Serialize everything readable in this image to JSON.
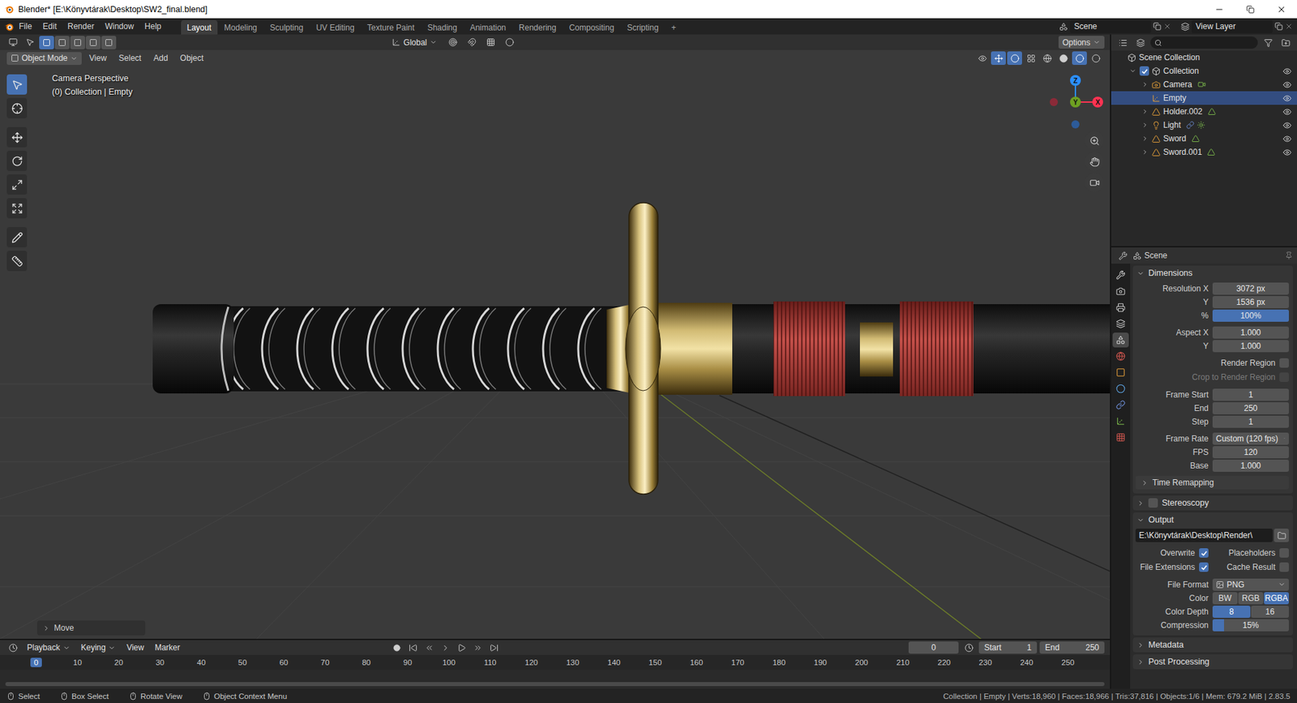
{
  "window": {
    "title": "Blender* [E:\\Könyvtárak\\Desktop\\SW2_final.blend]"
  },
  "topbar": {
    "menus": [
      "File",
      "Edit",
      "Render",
      "Window",
      "Help"
    ],
    "workspaces": [
      {
        "label": "Layout",
        "selected": true
      },
      {
        "label": "Modeling",
        "selected": false
      },
      {
        "label": "Sculpting",
        "selected": false
      },
      {
        "label": "UV Editing",
        "selected": false
      },
      {
        "label": "Texture Paint",
        "selected": false
      },
      {
        "label": "Shading",
        "selected": false
      },
      {
        "label": "Animation",
        "selected": false
      },
      {
        "label": "Rendering",
        "selected": false
      },
      {
        "label": "Compositing",
        "selected": false
      },
      {
        "label": "Scripting",
        "selected": false
      }
    ],
    "add_workspace": "+",
    "scene": "Scene",
    "view_layer": "View Layer"
  },
  "tool_header": {
    "orientation": "Global",
    "options": "Options"
  },
  "viewport_header": {
    "mode": "Object Mode",
    "menus": [
      "View",
      "Select",
      "Add",
      "Object"
    ]
  },
  "viewport": {
    "view_name": "Camera Perspective",
    "context": "(0) Collection | Empty",
    "gizmo": {
      "z": "Z",
      "y": "Y",
      "x": "X"
    },
    "tools": [
      {
        "kind": "select-box",
        "selected": true
      },
      {
        "kind": "cursor",
        "selected": false
      },
      {
        "kind": "move",
        "selected": false
      },
      {
        "kind": "rotate",
        "selected": false
      },
      {
        "kind": "scale",
        "selected": false
      },
      {
        "kind": "transform",
        "selected": false
      },
      {
        "kind": "annotate",
        "selected": false
      },
      {
        "kind": "measure",
        "selected": false
      }
    ],
    "last_operator": "Move"
  },
  "outliner": {
    "items": [
      {
        "name": "Scene Collection",
        "kind": "scene-collection",
        "depth": 0,
        "expandable": false,
        "expanded": false,
        "selected": false
      },
      {
        "name": "Collection",
        "kind": "collection",
        "depth": 1,
        "expandable": true,
        "expanded": true,
        "included": true,
        "selected": false,
        "visible": true
      },
      {
        "name": "Camera",
        "kind": "camera",
        "depth": 2,
        "expandable": true,
        "expanded": false,
        "selected": false,
        "visible": true
      },
      {
        "name": "Empty",
        "kind": "empty",
        "depth": 2,
        "expandable": false,
        "expanded": false,
        "selected": true,
        "visible": true
      },
      {
        "name": "Holder.002",
        "kind": "mesh",
        "depth": 2,
        "expandable": true,
        "expanded": false,
        "selected": false,
        "visible": true
      },
      {
        "name": "Light",
        "kind": "light",
        "depth": 2,
        "expandable": true,
        "expanded": false,
        "selected": false,
        "visible": true
      },
      {
        "name": "Sword",
        "kind": "mesh",
        "depth": 2,
        "expandable": true,
        "expanded": false,
        "selected": false,
        "visible": true
      },
      {
        "name": "Sword.001",
        "kind": "mesh",
        "depth": 2,
        "expandable": true,
        "expanded": false,
        "selected": false,
        "visible": true
      }
    ]
  },
  "properties": {
    "context": "Scene",
    "tabs": [
      {
        "kind": "tool",
        "selected": false
      },
      {
        "kind": "render",
        "selected": false
      },
      {
        "kind": "output",
        "selected": false
      },
      {
        "kind": "view-layer",
        "selected": false
      },
      {
        "kind": "scene",
        "selected": true
      },
      {
        "kind": "world",
        "selected": false
      },
      {
        "kind": "object",
        "selected": false
      },
      {
        "kind": "physics",
        "selected": false
      },
      {
        "kind": "constraints",
        "selected": false
      },
      {
        "kind": "data",
        "selected": false
      },
      {
        "kind": "texture",
        "selected": false
      }
    ],
    "panels": [
      {
        "title": "Dimensions",
        "kind": "plain",
        "expanded": true,
        "groups": [
          [
            {
              "kind": "number",
              "label": "Resolution X",
              "value": "3072 px"
            },
            {
              "kind": "number",
              "label": "Y",
              "value": "1536 px"
            },
            {
              "kind": "slider",
              "label": "%",
              "value": "100%",
              "level": 1
            }
          ],
          [
            {
              "kind": "number",
              "label": "Aspect X",
              "value": "1.000"
            },
            {
              "kind": "number",
              "label": "Y",
              "value": "1.000"
            }
          ],
          [
            {
              "kind": "checkbox",
              "label": "Render Region",
              "checked": false,
              "disabled": false
            },
            {
              "kind": "checkbox",
              "label": "Crop to Render Region",
              "checked": false,
              "disabled": true
            }
          ],
          [
            {
              "kind": "number",
              "label": "Frame Start",
              "value": "1"
            },
            {
              "kind": "number",
              "label": "End",
              "value": "250"
            },
            {
              "kind": "number",
              "label": "Step",
              "value": "1"
            }
          ],
          [
            {
              "kind": "select",
              "label": "Frame Rate",
              "value": "Custom (120 fps)"
            },
            {
              "kind": "number",
              "label": "FPS",
              "value": "120"
            },
            {
              "kind": "number",
              "label": "Base",
              "value": "1.000"
            }
          ],
          [
            {
              "kind": "subpanel",
              "label": "Time Remapping",
              "expanded": false
            }
          ]
        ]
      },
      {
        "title": "Stereoscopy",
        "kind": "checkbox",
        "checked": false,
        "expanded": false
      },
      {
        "title": "Output",
        "kind": "plain",
        "expanded": true,
        "groups": [
          [
            {
              "kind": "path",
              "value": "E:\\Könyvtárak\\Desktop\\Render\\"
            }
          ],
          [
            {
              "kind": "check-pair",
              "items": [
                {
                  "label": "Overwrite",
                  "checked": true
                },
                {
                  "label": "Placeholders",
                  "checked": false
                }
              ]
            },
            {
              "kind": "check-pair",
              "items": [
                {
                  "label": "File Extensions",
                  "checked": true
                },
                {
                  "label": "Cache Result",
                  "checked": false
                }
              ]
            }
          ],
          [
            {
              "kind": "select",
              "label": "File Format",
              "value": "PNG"
            },
            {
              "kind": "segmented",
              "label": "Color",
              "options": [
                {
                  "label": "BW",
                  "selected": false
                },
                {
                  "label": "RGB",
                  "selected": false
                },
                {
                  "label": "RGBA",
                  "selected": true
                }
              ]
            },
            {
              "kind": "segmented",
              "label": "Color Depth",
              "options": [
                {
                  "label": "8",
                  "selected": true
                },
                {
                  "label": "16",
                  "selected": false
                }
              ]
            },
            {
              "kind": "slider",
              "label": "Compression",
              "value": "15%",
              "level": 0.15
            }
          ]
        ]
      },
      {
        "title": "Metadata",
        "kind": "plain",
        "expanded": false
      },
      {
        "title": "Post Processing",
        "kind": "plain",
        "expanded": false
      }
    ]
  },
  "timeline": {
    "menus": [
      {
        "label": "Playback",
        "dropdown": true
      },
      {
        "label": "Keying",
        "dropdown": true
      },
      {
        "label": "View",
        "dropdown": false
      },
      {
        "label": "Marker",
        "dropdown": false
      }
    ],
    "current_frame": "0",
    "start_label": "Start",
    "start": "1",
    "end_label": "End",
    "end": "250",
    "ruler": [
      {
        "label": "0",
        "current": true
      },
      {
        "label": "10",
        "current": false
      },
      {
        "label": "20",
        "current": false
      },
      {
        "label": "30",
        "current": false
      },
      {
        "label": "40",
        "current": false
      },
      {
        "label": "50",
        "current": false
      },
      {
        "label": "60",
        "current": false
      },
      {
        "label": "70",
        "current": false
      },
      {
        "label": "80",
        "current": false
      },
      {
        "label": "90",
        "current": false
      },
      {
        "label": "100",
        "current": false
      },
      {
        "label": "110",
        "current": false
      },
      {
        "label": "120",
        "current": false
      },
      {
        "label": "130",
        "current": false
      },
      {
        "label": "140",
        "current": false
      },
      {
        "label": "150",
        "current": false
      },
      {
        "label": "160",
        "current": false
      },
      {
        "label": "170",
        "current": false
      },
      {
        "label": "180",
        "current": false
      },
      {
        "label": "190",
        "current": false
      },
      {
        "label": "200",
        "current": false
      },
      {
        "label": "210",
        "current": false
      },
      {
        "label": "220",
        "current": false
      },
      {
        "label": "230",
        "current": false
      },
      {
        "label": "240",
        "current": false
      },
      {
        "label": "250",
        "current": false
      }
    ]
  },
  "status_bar": {
    "hints": [
      "Select",
      "Box Select",
      "Rotate View",
      "Object Context Menu"
    ],
    "stats": "Collection | Empty | Verts:18,960 | Faces:18,966 | Tris:37,816 | Objects:1/6 | Mem: 679.2 MiB | 2.83.5"
  }
}
